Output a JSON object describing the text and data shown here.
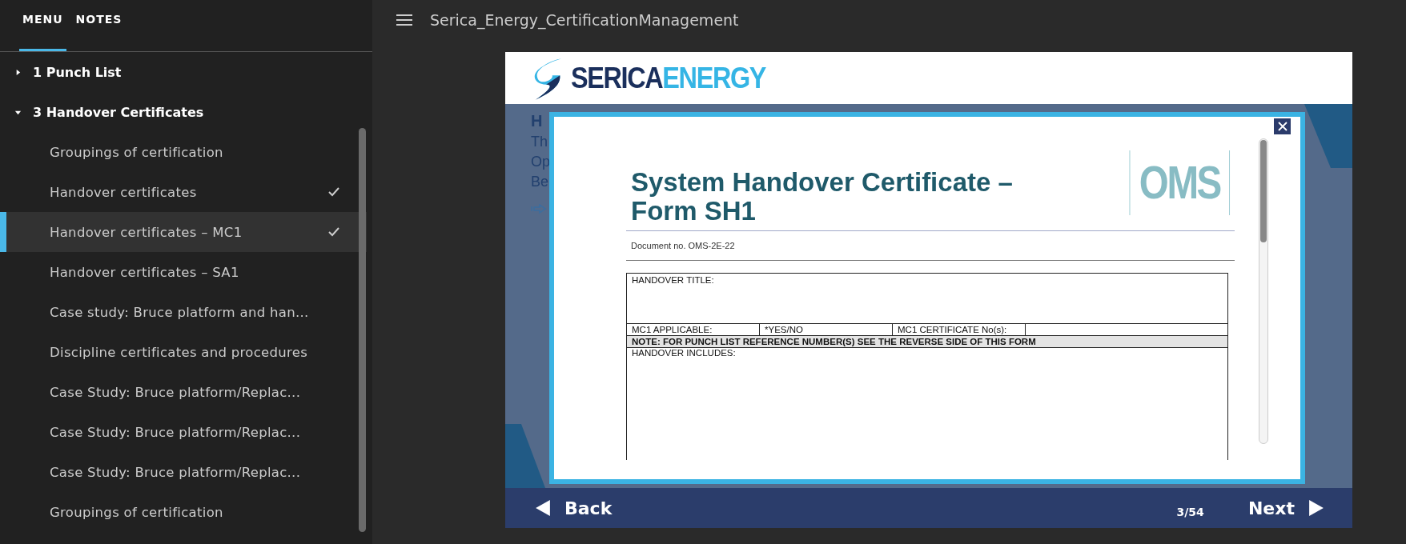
{
  "sidebar": {
    "tabs": [
      {
        "label": "MENU",
        "selected": true
      },
      {
        "label": "NOTES",
        "selected": false
      }
    ],
    "sections": [
      {
        "label": "1 Punch List",
        "expanded": false
      },
      {
        "label": "3 Handover Certificates",
        "expanded": true,
        "children": [
          {
            "label": "Groupings of certification",
            "completed": false,
            "selected": false
          },
          {
            "label": "Handover certificates",
            "completed": true,
            "selected": false
          },
          {
            "label": "Handover certificates – MC1",
            "completed": true,
            "selected": true
          },
          {
            "label": "Handover certificates – SA1",
            "completed": false,
            "selected": false
          },
          {
            "label": "Case study: Bruce platform and han...",
            "completed": false,
            "selected": false
          },
          {
            "label": "Discipline certificates and procedures",
            "completed": false,
            "selected": false
          },
          {
            "label": "Case Study: Bruce platform/Replac...",
            "completed": false,
            "selected": false
          },
          {
            "label": "Case Study: Bruce platform/Replac...",
            "completed": false,
            "selected": false
          },
          {
            "label": "Case Study: Bruce platform/Replac...",
            "completed": false,
            "selected": false
          },
          {
            "label": "Groupings of certification",
            "completed": false,
            "selected": false
          }
        ]
      }
    ]
  },
  "header": {
    "title": "Serica_Energy_CertificationManagement"
  },
  "slide": {
    "logo": {
      "dark": "SERICA",
      "light": "ENERGY"
    },
    "heading": "H",
    "lines": [
      "Th",
      "Op",
      "Be"
    ],
    "document": {
      "title_lines": [
        "System Handover Certificate –",
        "Form SH1"
      ],
      "badge": "OMS",
      "doc_number": "Document no. OMS-2E-22",
      "handover_title": "HANDOVER TITLE:",
      "mc1_applicable": "MC1 APPLICABLE:",
      "yes_no": "*YES/NO",
      "mc1_certificate": "MC1 CERTIFICATE No(s):",
      "note": "NOTE: FOR PUNCH LIST REFERENCE NUMBER(S) SEE THE REVERSE SIDE OF THIS FORM",
      "handover_includes": "HANDOVER INCLUDES:"
    }
  },
  "nav": {
    "back": "Back",
    "page": "3/54",
    "next": "Next"
  }
}
